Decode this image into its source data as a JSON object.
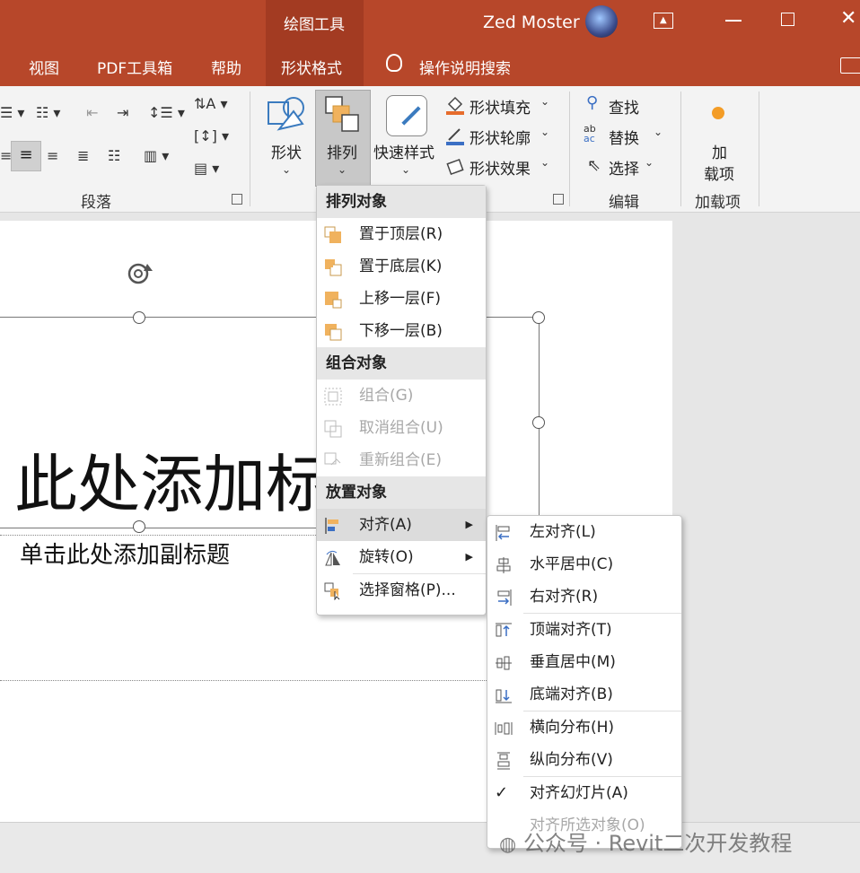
{
  "titlebar": {
    "context_tab": "绘图工具",
    "user": "Zed Moster",
    "tabs": [
      "视图",
      "PDF工具箱",
      "帮助",
      "形状格式"
    ],
    "tell_me": "操作说明搜索"
  },
  "ribbon": {
    "paragraph_group": "段落",
    "shape_label": "形状",
    "arrange_label": "排列",
    "quick_styles_label": "快速样式",
    "fill_label": "形状填充",
    "outline_label": "形状轮廓",
    "effects_label": "形状效果",
    "find_label": "查找",
    "replace_label": "替换",
    "select_label": "选择",
    "editing_group": "编辑",
    "addins_label_1": "加",
    "addins_label_2": "载项",
    "addins_group": "加载项"
  },
  "slide": {
    "title_fragment": "此处添加标",
    "subtitle": "单击此处添加副标题"
  },
  "arrange_menu": {
    "section_order": "排列对象",
    "bring_to_front": "置于顶层(R)",
    "send_to_back": "置于底层(K)",
    "bring_forward": "上移一层(F)",
    "send_backward": "下移一层(B)",
    "section_group": "组合对象",
    "group": "组合(G)",
    "ungroup": "取消组合(U)",
    "regroup": "重新组合(E)",
    "section_position": "放置对象",
    "align": "对齐(A)",
    "rotate": "旋转(O)",
    "selection_pane": "选择窗格(P)..."
  },
  "align_menu": {
    "align_left": "左对齐(L)",
    "align_center": "水平居中(C)",
    "align_right": "右对齐(R)",
    "align_top": "顶端对齐(T)",
    "align_middle": "垂直居中(M)",
    "align_bottom": "底端对齐(B)",
    "distribute_horizontal": "横向分布(H)",
    "distribute_vertical": "纵向分布(V)",
    "align_to_slide": "对齐幻灯片(A)",
    "align_selected": "对齐所选对象(O)"
  },
  "watermark": "公众号 · Revit二次开发教程",
  "colors": {
    "accent": "#b7472a",
    "accent_dark": "#a33b22"
  }
}
